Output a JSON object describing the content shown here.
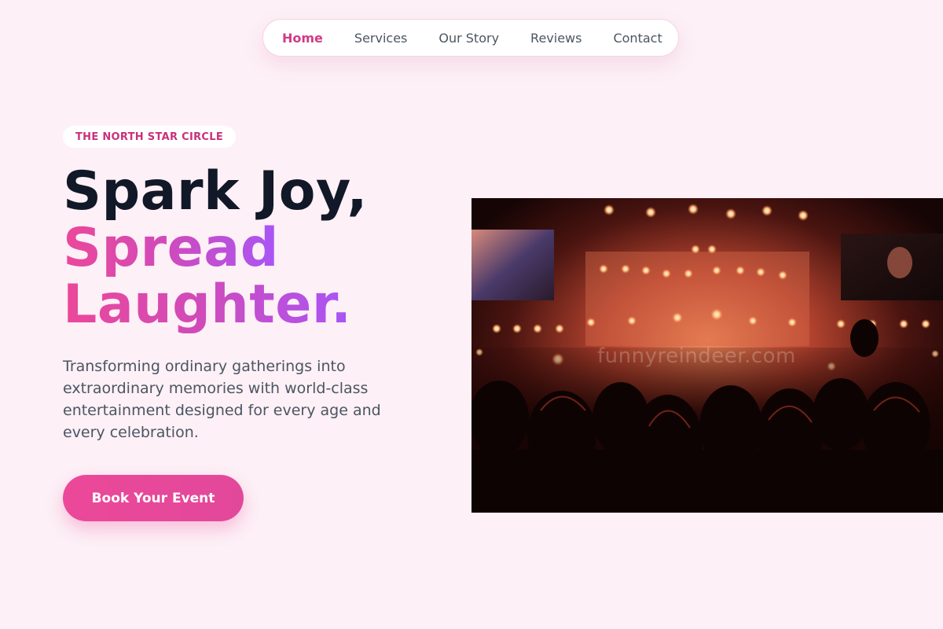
{
  "nav": {
    "items": [
      {
        "label": "Home",
        "active": true
      },
      {
        "label": "Services",
        "active": false
      },
      {
        "label": "Our Story",
        "active": false
      },
      {
        "label": "Reviews",
        "active": false
      },
      {
        "label": "Contact",
        "active": false
      }
    ]
  },
  "hero": {
    "badge": "THE NORTH STAR CIRCLE",
    "headline_line1": "Spark Joy,",
    "headline_line2": "Spread",
    "headline_line3": "Laughter.",
    "description": "Transforming ordinary gatherings into extraordinary memories with world-class entertainment designed for every age and every celebration.",
    "cta_label": "Book Your Event",
    "image_watermark": "funnyreindeer.com"
  },
  "colors": {
    "background": "#fdf0f6",
    "accent_pink": "#ec4899",
    "accent_purple": "#a855f7",
    "heading_dark": "#111827",
    "body_text": "#4b5563"
  },
  "icons": {
    "hero_image": "concert-crowd-photo"
  }
}
